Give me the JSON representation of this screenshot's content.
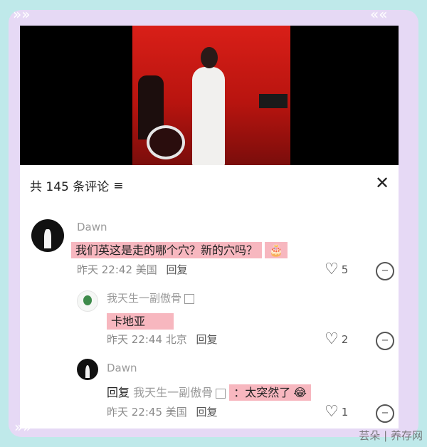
{
  "header": {
    "comment_count": "共 145 条评论",
    "sort_icon": "sort-lines-icon",
    "close_icon": "close-icon"
  },
  "comments": [
    {
      "user": "Dawn",
      "text": "我们英这是走的哪个穴？新的穴吗？",
      "emoji": "🎂",
      "time": "昨天 22:42 美国",
      "reply": "回复",
      "likes": "5"
    },
    {
      "user": "我天生一副傲骨",
      "text": "卡地亚",
      "time": "昨天 22:44 北京",
      "reply": "回复",
      "likes": "2"
    },
    {
      "user": "Dawn",
      "reply_prefix": "回复",
      "reply_target": "我天生一副傲骨",
      "text": "：太突然了",
      "emoji": "😂",
      "time": "昨天 22:45 美国",
      "reply": "回复",
      "likes": "1"
    }
  ],
  "watermark": "芸朵 | 养存网"
}
